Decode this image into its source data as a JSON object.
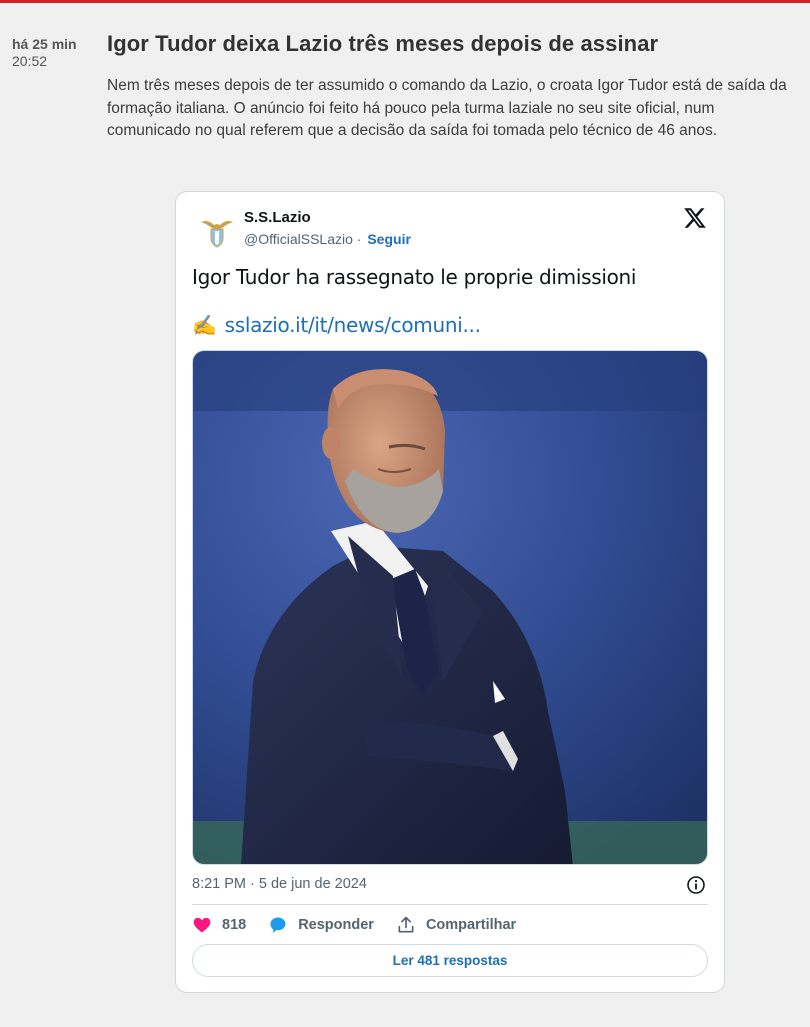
{
  "entry": {
    "time_relative": "há 25 min",
    "time_absolute": "20:52",
    "headline": "Igor Tudor deixa Lazio três meses depois de assinar",
    "lead": "Nem três meses depois de ter assumido o comando da Lazio, o croata Igor Tudor está de saída da formação italiana. O anúncio foi feito há pouco pela turma laziale no seu site oficial, num comunicado no qual referem que a decisão da saída foi tomada pelo técnico de 46 anos."
  },
  "tweet": {
    "author_name": "S.S.Lazio",
    "author_handle": "@OfficialSSLazio",
    "separator": "·",
    "follow_label": "Seguir",
    "text": "Igor Tudor ha rassegnato le proprie dimissioni",
    "link_emoji": "✍️",
    "link_text": "sslazio.it/it/news/comuni...",
    "timestamp": "8:21 PM · 5 de jun de 2024",
    "like_count": "818",
    "reply_label": "Responder",
    "share_label": "Compartilhar",
    "read_replies_label": "Ler 481 respostas"
  },
  "colors": {
    "accent_red": "#d2232a",
    "link_blue": "#1d6fb8",
    "like_pink": "#f91880",
    "reply_blue": "#1d9bf0"
  },
  "icons": [
    "lazio-logo-icon",
    "x-logo-icon",
    "info-icon",
    "heart-icon",
    "reply-bubble-icon",
    "share-icon"
  ]
}
